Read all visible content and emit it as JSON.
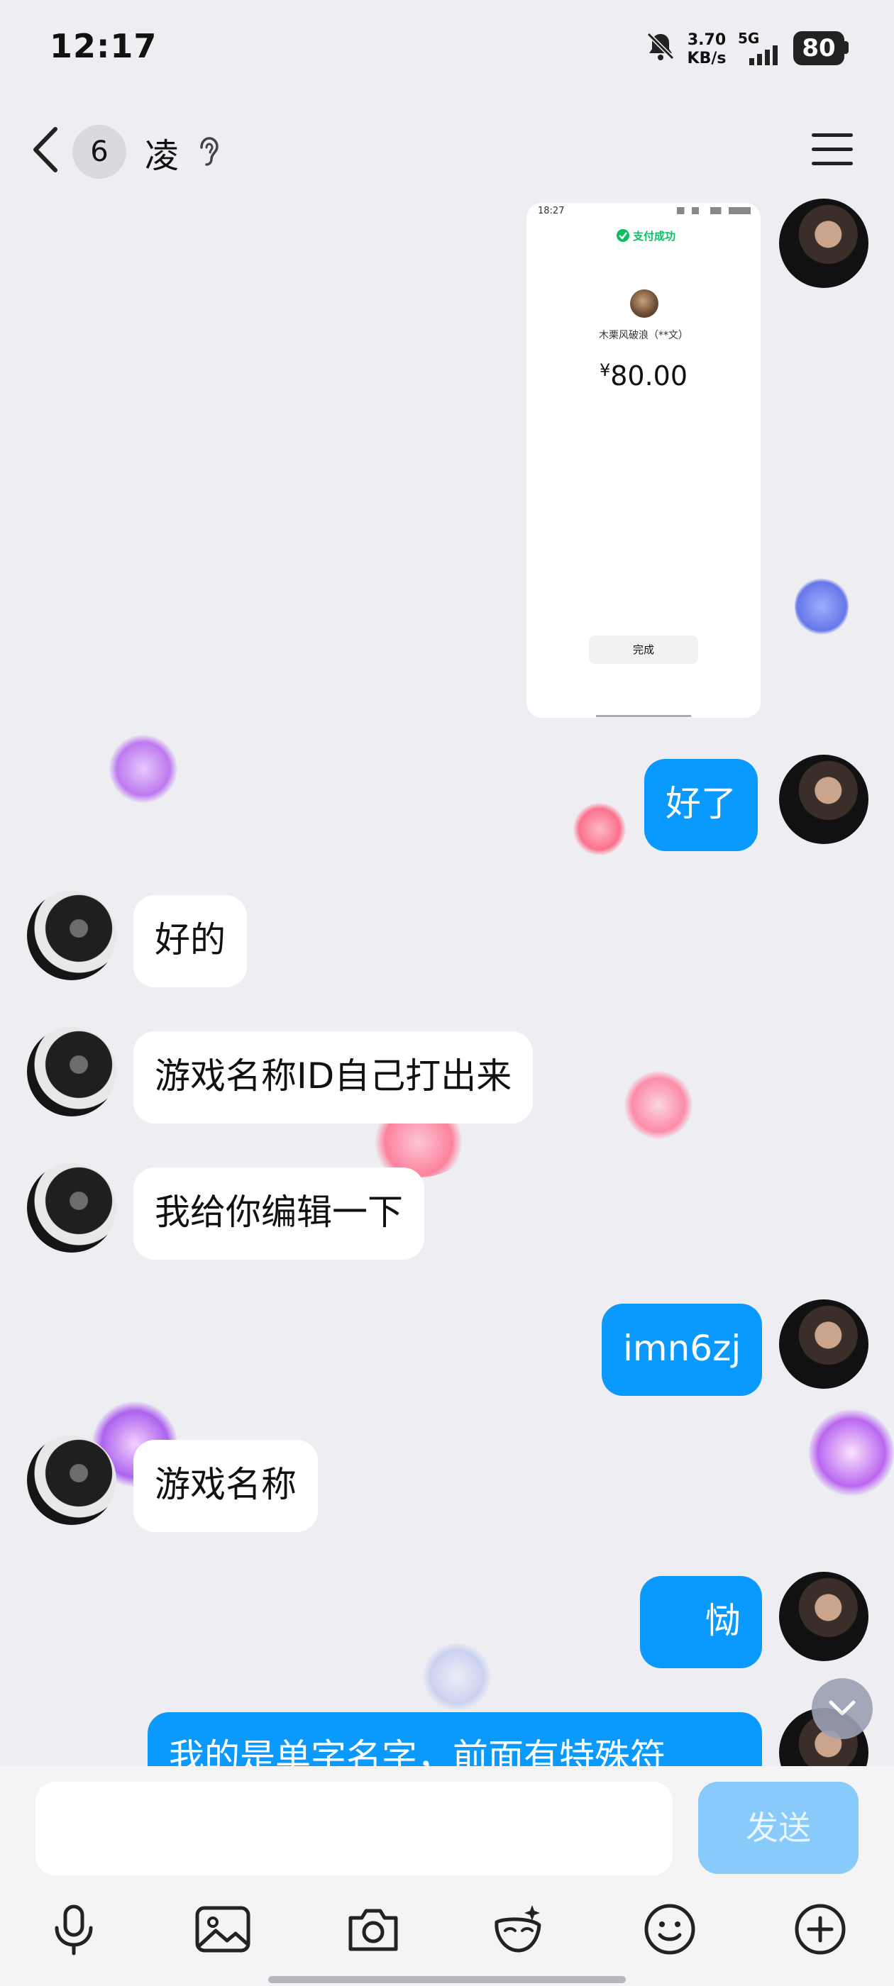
{
  "status_bar": {
    "time": "12:17",
    "net_speed_value": "3.70",
    "net_speed_unit": "KB/s",
    "network_type": "5G",
    "battery": "80"
  },
  "header": {
    "unread_count": "6",
    "title": "凌"
  },
  "payment_screenshot": {
    "time": "18:27",
    "status": "支付成功",
    "payee": "木栗风破浪（**文）",
    "currency": "¥",
    "amount": "80.00",
    "done_label": "完成"
  },
  "messages": [
    {
      "side": "out",
      "text": "好了"
    },
    {
      "side": "in",
      "text": "好的"
    },
    {
      "side": "in",
      "text": "游戏名称ID自己打出来"
    },
    {
      "side": "in",
      "text": "我给你编辑一下"
    },
    {
      "side": "out",
      "text": "imn6zj"
    },
    {
      "side": "in",
      "text": "游戏名称"
    },
    {
      "side": "out",
      "text": "恸"
    },
    {
      "side": "out",
      "text": "我的是单字名字，前面有特殊符"
    }
  ],
  "composer": {
    "input_value": "",
    "send_label": "发送"
  },
  "colors": {
    "outgoing_bubble": "#0a99ff",
    "incoming_bubble": "#ffffff",
    "background": "#eeeef2",
    "send_button": "#88cafa"
  },
  "icons": [
    "bell-mute-icon",
    "signal-icon",
    "back-icon",
    "ear-icon",
    "menu-icon",
    "scroll-down-icon",
    "mic-icon",
    "image-icon",
    "camera-icon",
    "sticker-icon",
    "emoji-icon",
    "plus-icon"
  ]
}
